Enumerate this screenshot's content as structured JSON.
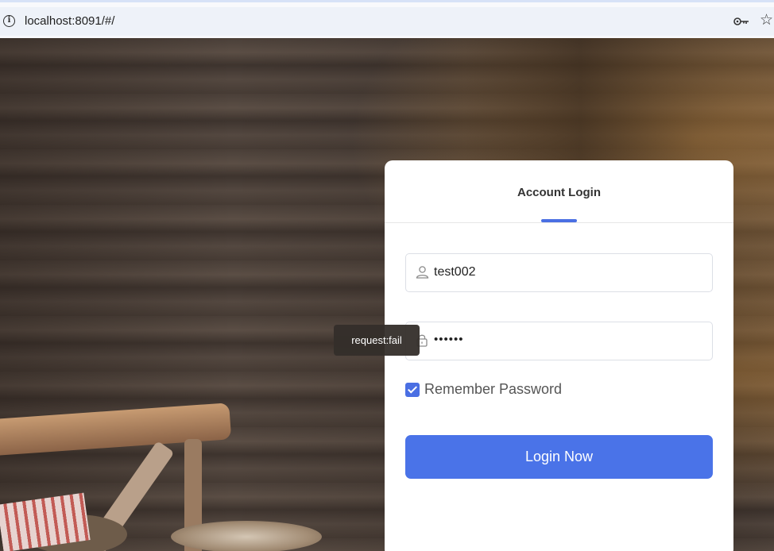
{
  "browser": {
    "url": "localhost:8091/#/"
  },
  "login": {
    "title": "Account Login",
    "username_value": "test002",
    "password_value": "••••••",
    "remember_label": "Remember Password",
    "remember_checked": true,
    "submit_label": "Login Now"
  },
  "toast": {
    "message": "request:fail"
  },
  "icons": {
    "info": "info-icon",
    "key": "key-icon",
    "star": "star-icon",
    "user": "user-icon",
    "lock": "lock-icon"
  },
  "colors": {
    "accent": "#4a73e8",
    "toast_bg": "#342e2a"
  }
}
